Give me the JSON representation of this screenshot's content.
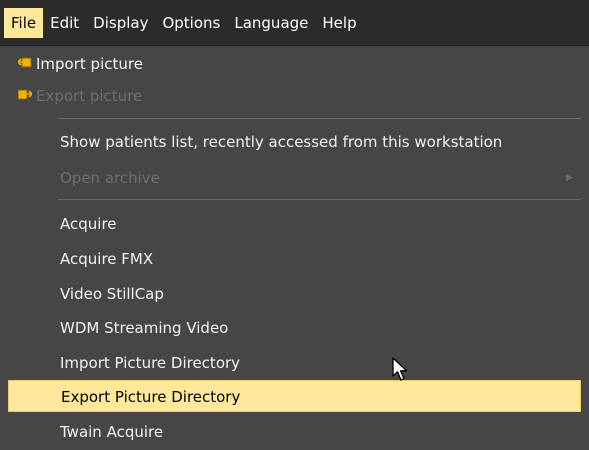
{
  "menubar": {
    "items": [
      {
        "label": "File"
      },
      {
        "label": "Edit"
      },
      {
        "label": "Display"
      },
      {
        "label": "Options"
      },
      {
        "label": "Language"
      },
      {
        "label": "Help"
      }
    ]
  },
  "file_menu": {
    "import_picture": "Import picture",
    "export_picture": "Export picture",
    "show_patients": "Show patients list, recently accessed from this workstation",
    "open_archive": "Open archive",
    "acquire": "Acquire",
    "acquire_fmx": "Acquire FMX",
    "video_stillcap": "Video StillCap",
    "wdm_streaming": "WDM Streaming Video",
    "import_dir": "Import Picture Directory",
    "export_dir": "Export Picture Directory",
    "twain": "Twain Acquire",
    "highlighted_item": "Export Picture Directory",
    "disabled_items": [
      "Export picture",
      "Open archive"
    ]
  },
  "icons": {
    "import": "import-picture-icon",
    "export": "export-picture-icon",
    "submenu": "submenu-arrow-icon",
    "cursor": "mouse-cursor-icon"
  },
  "colors": {
    "menubar_bg": "#2b2b2b",
    "menu_bg": "#464646",
    "highlight": "#ffe89a",
    "icon_accent": "#f0b400",
    "disabled_text": "#6e6e6e"
  }
}
